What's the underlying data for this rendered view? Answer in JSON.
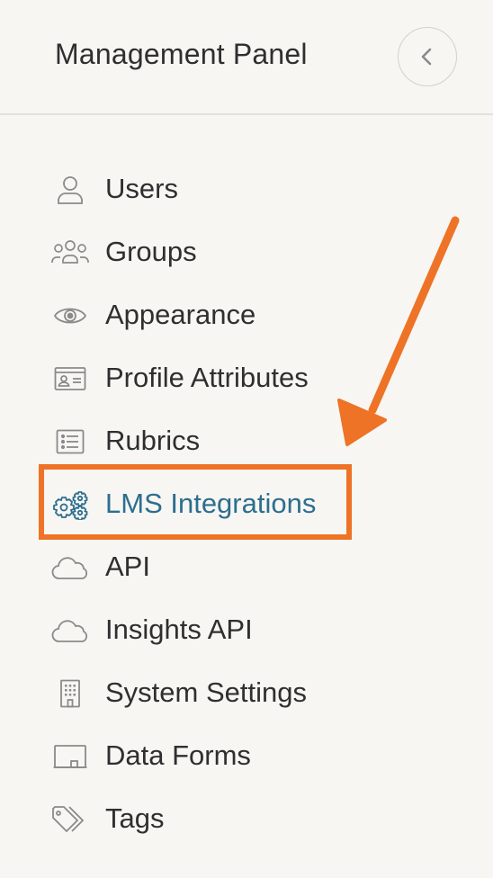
{
  "header": {
    "title": "Management Panel",
    "collapse_icon": "chevron-left-icon"
  },
  "nav": {
    "items": [
      {
        "label": "Users",
        "icon": "user-icon"
      },
      {
        "label": "Groups",
        "icon": "groups-icon"
      },
      {
        "label": "Appearance",
        "icon": "eye-icon"
      },
      {
        "label": "Profile Attributes",
        "icon": "id-card-icon"
      },
      {
        "label": "Rubrics",
        "icon": "list-icon"
      },
      {
        "label": "LMS Integrations",
        "icon": "gears-icon",
        "active": true
      },
      {
        "label": "API",
        "icon": "cloud-icon"
      },
      {
        "label": "Insights API",
        "icon": "cloud-icon"
      },
      {
        "label": "System Settings",
        "icon": "building-icon"
      },
      {
        "label": "Data Forms",
        "icon": "form-icon"
      },
      {
        "label": "Tags",
        "icon": "tags-icon"
      }
    ]
  },
  "annotation": {
    "highlighted_item": "LMS Integrations",
    "highlight_color": "#ee7326"
  },
  "colors": {
    "background": "#f7f6f3",
    "text": "#2f2f2f",
    "active_text": "#2d6e8e",
    "icon": "#8a8a8a",
    "active_icon": "#2d6e8e",
    "divider": "#e3e1dd"
  }
}
